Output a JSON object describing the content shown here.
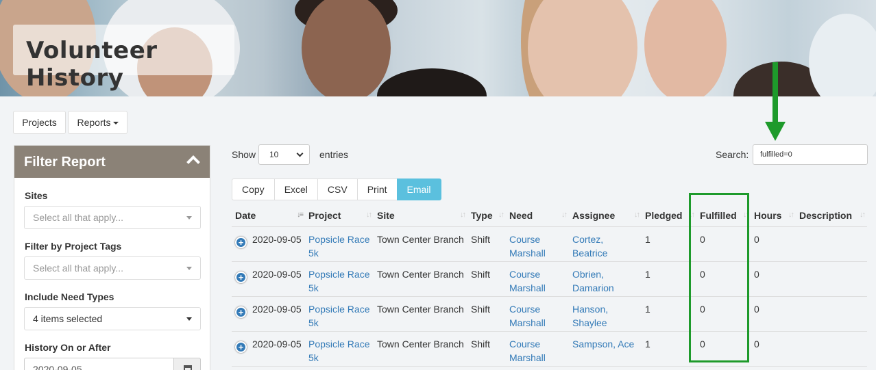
{
  "banner": {
    "title": "Volunteer History"
  },
  "nav": {
    "projects_label": "Projects",
    "reports_label": "Reports"
  },
  "filter": {
    "title": "Filter Report",
    "sites_label": "Sites",
    "sites_placeholder": "Select all that apply...",
    "tags_label": "Filter by Project Tags",
    "tags_placeholder": "Select all that apply...",
    "need_types_label": "Include Need Types",
    "need_types_value": "4 items selected",
    "history_label": "History On or After",
    "history_value": "2020-09-05"
  },
  "table_controls": {
    "show_label": "Show",
    "page_size": "10",
    "entries_label": "entries",
    "search_label": "Search:",
    "search_value": "fulfilled=0",
    "buttons": [
      "Copy",
      "Excel",
      "CSV",
      "Print",
      "Email"
    ]
  },
  "table": {
    "columns": [
      "Date",
      "Project",
      "Site",
      "Type",
      "Need",
      "Assignee",
      "Pledged",
      "Fulfilled",
      "Hours",
      "Description"
    ],
    "rows": [
      {
        "date": "2020-09-05",
        "project": "Popsicle Race 5k",
        "site": "Town Center Branch",
        "type": "Shift",
        "need": "Course Marshall",
        "assignee": "Cortez, Beatrice",
        "pledged": "1",
        "fulfilled": "0",
        "hours": "0",
        "description": ""
      },
      {
        "date": "2020-09-05",
        "project": "Popsicle Race 5k",
        "site": "Town Center Branch",
        "type": "Shift",
        "need": "Course Marshall",
        "assignee": "Obrien, Damarion",
        "pledged": "1",
        "fulfilled": "0",
        "hours": "0",
        "description": ""
      },
      {
        "date": "2020-09-05",
        "project": "Popsicle Race 5k",
        "site": "Town Center Branch",
        "type": "Shift",
        "need": "Course Marshall",
        "assignee": "Hanson, Shaylee",
        "pledged": "1",
        "fulfilled": "0",
        "hours": "0",
        "description": ""
      },
      {
        "date": "2020-09-05",
        "project": "Popsicle Race 5k",
        "site": "Town Center Branch",
        "type": "Shift",
        "need": "Course Marshall",
        "assignee": "Sampson, Ace",
        "pledged": "1",
        "fulfilled": "0",
        "hours": "0",
        "description": ""
      }
    ]
  },
  "colors": {
    "link": "#337ab7",
    "email_button": "#5bc0de",
    "annotation_green": "#1e9a2b",
    "filter_header": "#8b8277"
  }
}
